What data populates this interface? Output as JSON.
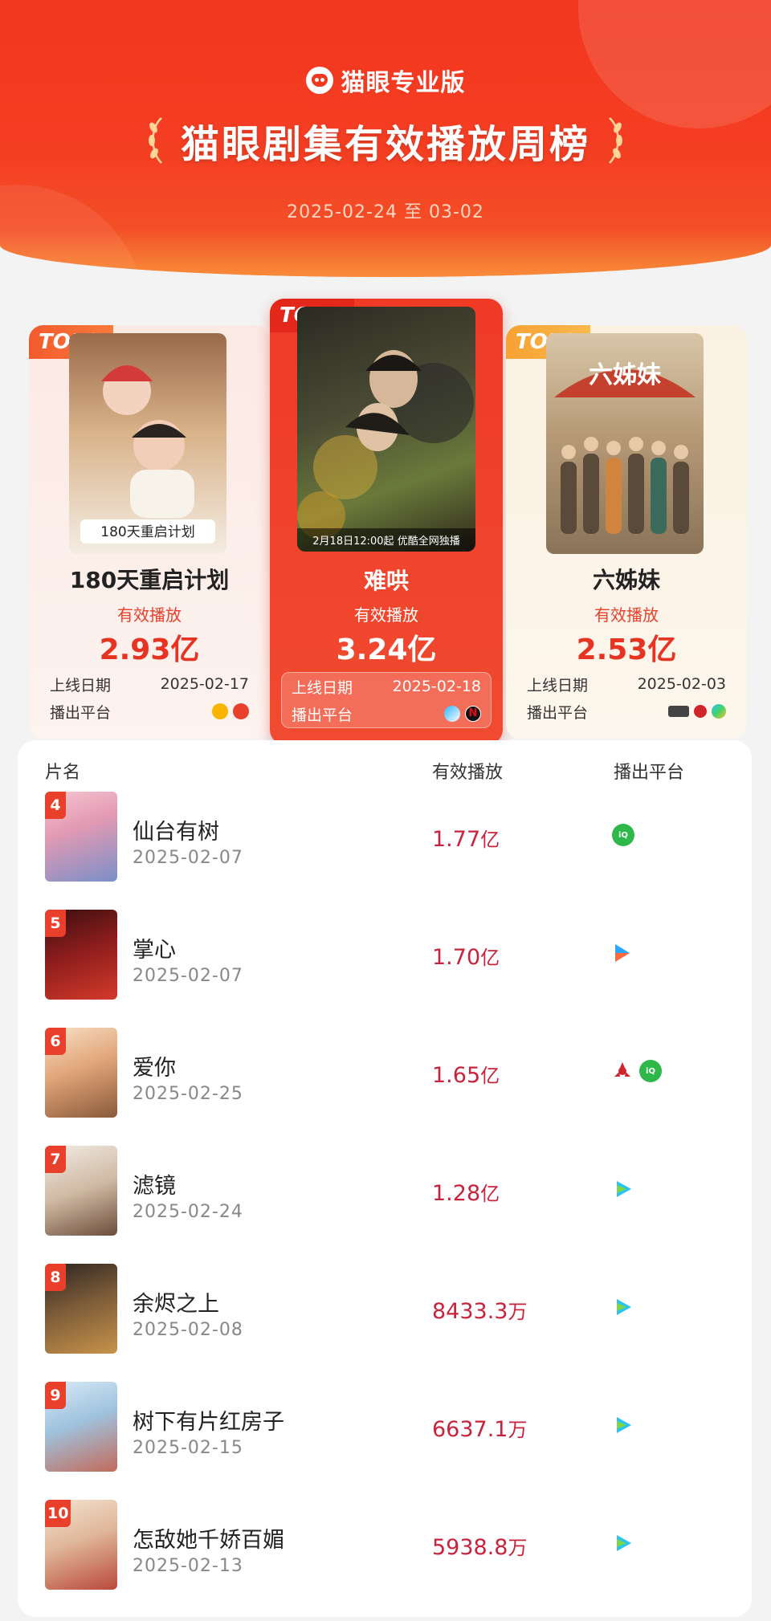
{
  "brand": "猫眼专业版",
  "title": "猫眼剧集有效播放周榜",
  "date_range": "2025-02-24 至 03-02",
  "podium": [
    {
      "rank_tag": "TOP2",
      "title": "180天重启计划",
      "label": "有效播放",
      "value": "2.93亿",
      "date_label": "上线日期",
      "date": "2025-02-17",
      "platform_label": "播出平台",
      "platforms": [
        "mango-tv-icon",
        "mgtv-red-icon"
      ]
    },
    {
      "rank_tag": "TOP1",
      "title": "难哄",
      "label": "有效播放",
      "value": "3.24亿",
      "date_label": "上线日期",
      "date": "2025-02-18",
      "platform_label": "播出平台",
      "platforms": [
        "youku-icon",
        "netflix-icon"
      ],
      "poster_caption": "2月18日12:00起 优酷全网独播"
    },
    {
      "rank_tag": "TOP3",
      "title": "六姊妹",
      "label": "有效播放",
      "value": "2.53亿",
      "date_label": "上线日期",
      "date": "2025-02-03",
      "platform_label": "播出平台",
      "platforms": [
        "cctv-icon",
        "cctv8-icon",
        "tencent-video-icon"
      ],
      "poster_caption": "六姊妹"
    }
  ],
  "list_header": {
    "name": "片名",
    "plays": "有效播放",
    "platform": "播出平台"
  },
  "list": [
    {
      "rank": "4",
      "title": "仙台有树",
      "date": "2025-02-07",
      "value": "1.77",
      "unit": "亿",
      "platforms": [
        "iqiyi-icon"
      ]
    },
    {
      "rank": "5",
      "title": "掌心",
      "date": "2025-02-07",
      "value": "1.70",
      "unit": "亿",
      "platforms": [
        "youku-icon"
      ]
    },
    {
      "rank": "6",
      "title": "爱你",
      "date": "2025-02-25",
      "value": "1.65",
      "unit": "亿",
      "platforms": [
        "cctv-icon",
        "iqiyi-icon"
      ]
    },
    {
      "rank": "7",
      "title": "滤镜",
      "date": "2025-02-24",
      "value": "1.28",
      "unit": "亿",
      "platforms": [
        "tencent-video-icon"
      ]
    },
    {
      "rank": "8",
      "title": "余烬之上",
      "date": "2025-02-08",
      "value": "8433.3",
      "unit": "万",
      "platforms": [
        "tencent-video-icon"
      ]
    },
    {
      "rank": "9",
      "title": "树下有片红房子",
      "date": "2025-02-15",
      "value": "6637.1",
      "unit": "万",
      "platforms": [
        "tencent-video-icon"
      ]
    },
    {
      "rank": "10",
      "title": "怎敌她千娇百媚",
      "date": "2025-02-13",
      "value": "5938.8",
      "unit": "万",
      "platforms": [
        "tencent-video-icon"
      ]
    }
  ]
}
